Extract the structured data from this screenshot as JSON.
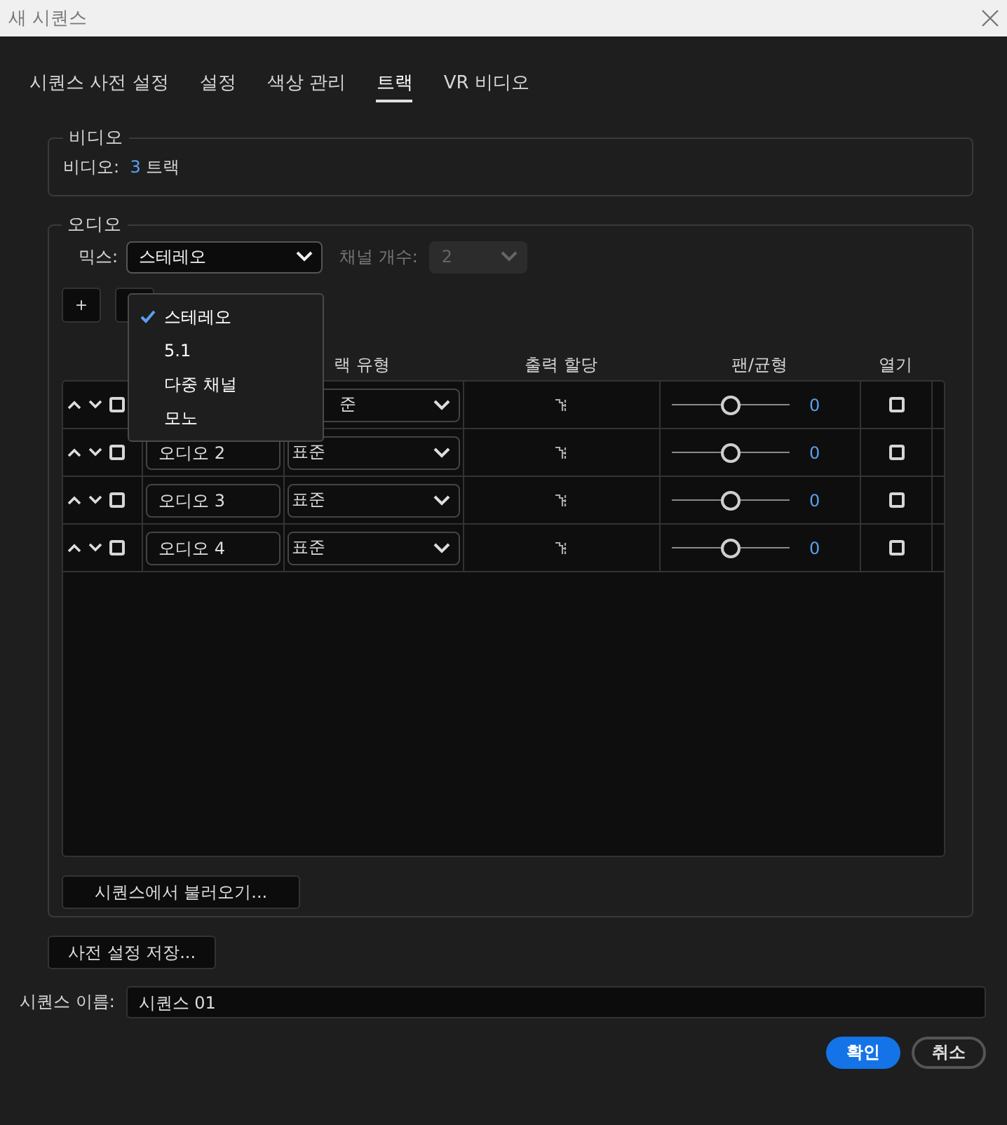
{
  "window": {
    "title": "새 시퀀스"
  },
  "tabs": [
    {
      "label": "시퀀스 사전 설정",
      "selected": false
    },
    {
      "label": "설정",
      "selected": false
    },
    {
      "label": "색상 관리",
      "selected": false
    },
    {
      "label": "트랙",
      "selected": true
    },
    {
      "label": "VR 비디오",
      "selected": false
    }
  ],
  "video": {
    "legend": "비디오",
    "label": "비디오:",
    "count": "3",
    "unit": "트랙"
  },
  "audio": {
    "legend": "오디오",
    "mix_label": "믹스:",
    "mix_value": "스테레오",
    "channels_label": "채널 개수:",
    "channels_value": "2",
    "channels_disabled": true,
    "add_button": "+",
    "mix_menu": [
      {
        "label": "스테레오",
        "selected": true
      },
      {
        "label": "5.1",
        "selected": false
      },
      {
        "label": "다중 채널",
        "selected": false
      },
      {
        "label": "모노",
        "selected": false
      }
    ],
    "columns": [
      "랙 유형",
      "출력 할당",
      "팬/균형",
      "열기"
    ],
    "tracks": [
      {
        "checked": false,
        "type": "준",
        "level": 0.5,
        "reading": "0",
        "open": false
      },
      {
        "checked": false,
        "name": "오디오 2",
        "type": "표준",
        "level": 0.5,
        "reading": "0",
        "open": false
      },
      {
        "checked": false,
        "name": "오디오 3",
        "type": "표준",
        "level": 0.5,
        "reading": "0",
        "open": false
      },
      {
        "checked": false,
        "name": "오디오 4",
        "type": "표준",
        "level": 0.5,
        "reading": "0",
        "open": false
      }
    ],
    "import_button": "시퀀스에서 불러오기..."
  },
  "save_preset_button": "사전 설정 저장...",
  "sequence_name": {
    "label": "시퀀스 이름:",
    "value": "시퀀스 01"
  },
  "buttons": [
    {
      "label": "확인",
      "kind": "primary"
    },
    {
      "label": "취소",
      "kind": "secondary"
    }
  ]
}
